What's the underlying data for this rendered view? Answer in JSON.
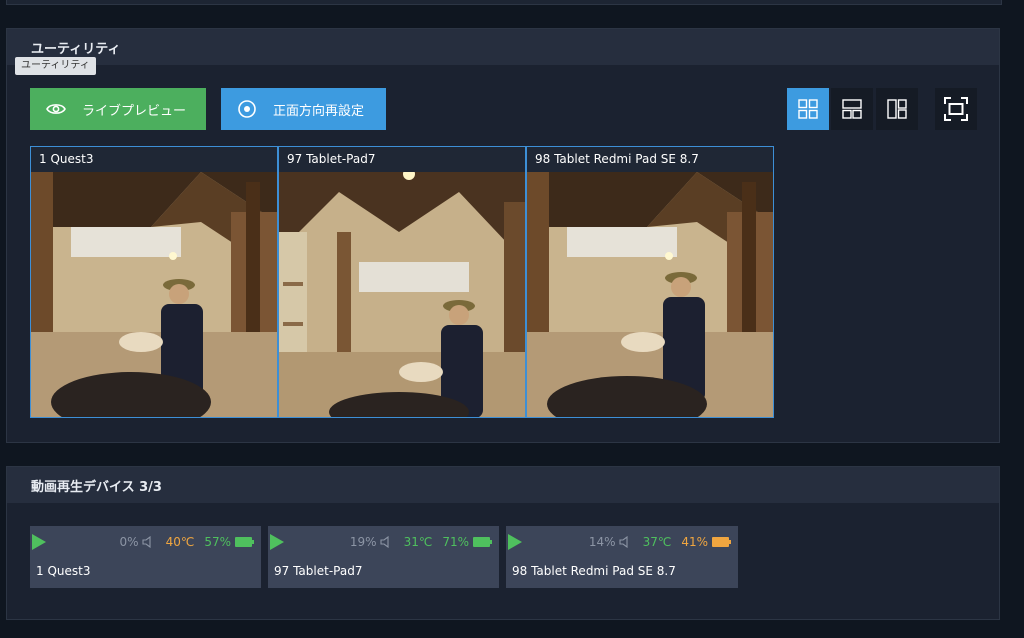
{
  "utility": {
    "title": "ユーティリティ",
    "tooltip": "ユーティリティ",
    "live_preview_label": "ライブプレビュー",
    "recenter_label": "正面方向再設定"
  },
  "previews": [
    {
      "label": "1 Quest3"
    },
    {
      "label": "97 Tablet-Pad7"
    },
    {
      "label": "98 Tablet Redmi Pad SE 8.7"
    }
  ],
  "devices": {
    "title": "動画再生デバイス 3/3",
    "items": [
      {
        "name": "1  Quest3",
        "volume": "0%",
        "temp": "40℃",
        "battery": "57%",
        "temp_color": "#f0a640",
        "battery_color": "#4fc05e"
      },
      {
        "name": "97  Tablet-Pad7",
        "volume": "19%",
        "temp": "31℃",
        "battery": "71%",
        "temp_color": "#4fc05e",
        "battery_color": "#4fc05e"
      },
      {
        "name": "98  Tablet Redmi Pad SE 8.7",
        "volume": "14%",
        "temp": "37℃",
        "battery": "41%",
        "temp_color": "#4fc05e",
        "battery_color": "#f0a640"
      }
    ]
  },
  "colors": {
    "accent_blue": "#3d9be0",
    "accent_green": "#4caf5e",
    "panel_bg": "#1b2230"
  }
}
